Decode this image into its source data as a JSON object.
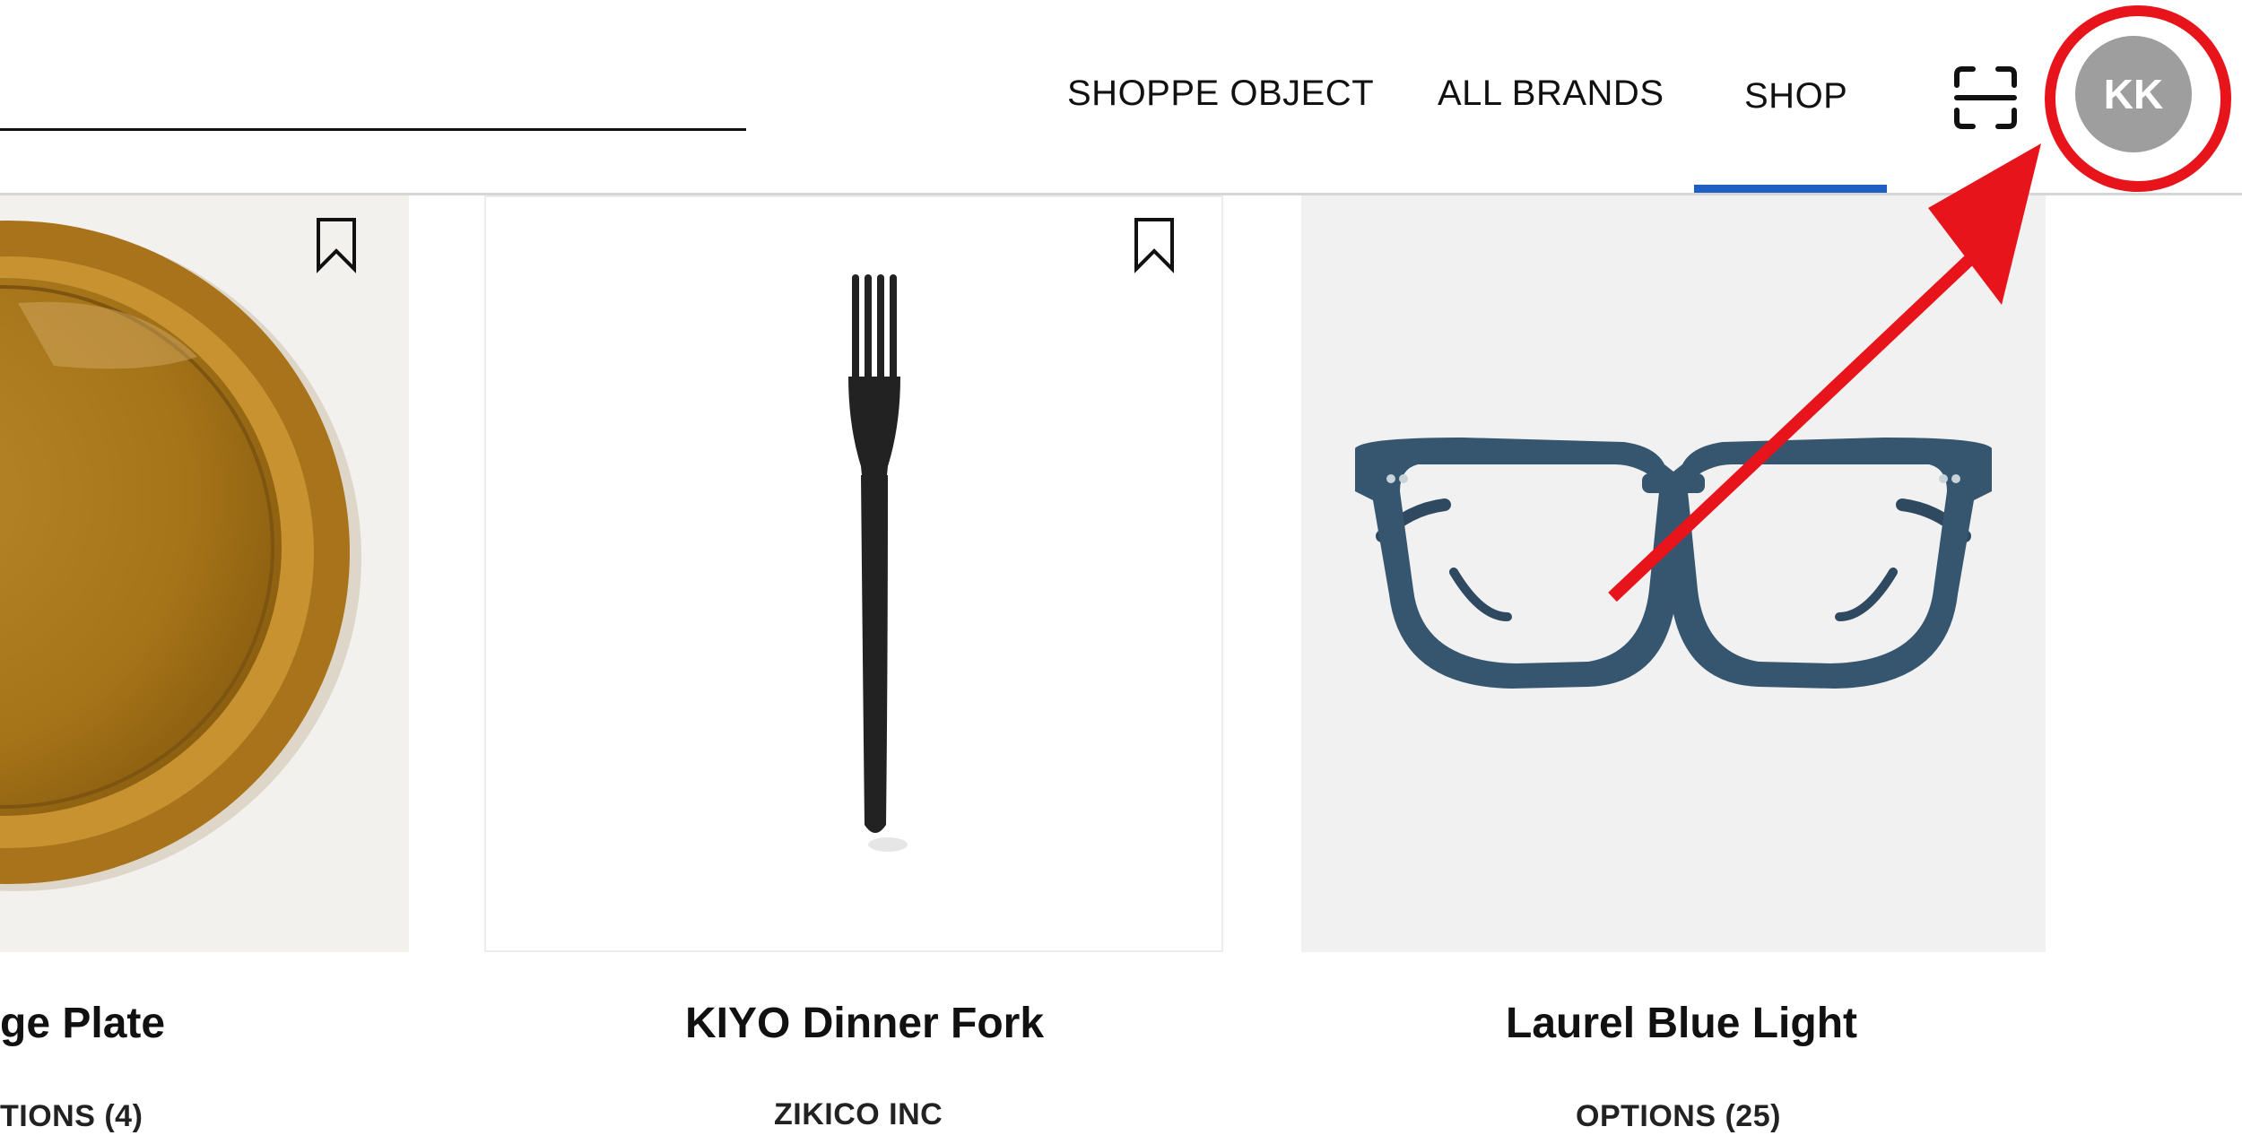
{
  "header": {
    "nav": [
      {
        "label": "SHOPPE OBJECT"
      },
      {
        "label": "ALL BRANDS"
      },
      {
        "label": "SHOP",
        "active": true
      }
    ],
    "avatar_initials": "KK",
    "accent_color": "#1f5fc3",
    "annotation_color": "#e8141b"
  },
  "products": [
    {
      "title": "ge Plate",
      "subtitle": "TIONS (4)",
      "image": "plate"
    },
    {
      "title": "KIYO Dinner Fork",
      "subtitle": "ZIKICO INC",
      "image": "fork"
    },
    {
      "title": "Laurel Blue Light",
      "subtitle": "OPTIONS (25)",
      "image": "glasses"
    }
  ],
  "icons": {
    "scan": "scan-icon",
    "bookmark": "bookmark-icon",
    "annotation": "arrow-annotation"
  }
}
